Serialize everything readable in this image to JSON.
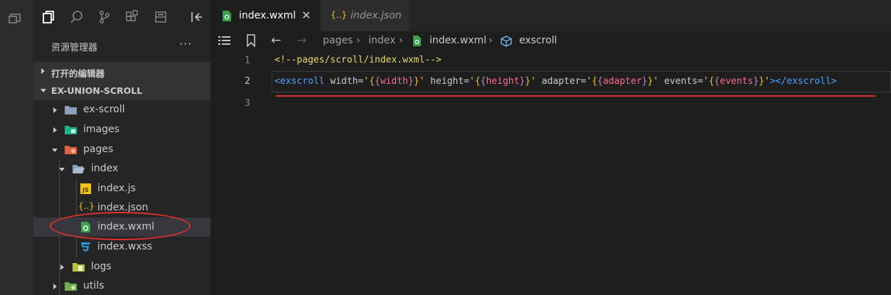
{
  "sidebar": {
    "title": "资源管理器",
    "more": "···",
    "sections": [
      {
        "label": "打开的编辑器",
        "expanded": false
      },
      {
        "label": "EX-UNION-SCROLL",
        "expanded": true
      }
    ],
    "tree": [
      {
        "label": "ex-scroll",
        "kind": "folder",
        "expanded": false
      },
      {
        "label": "images",
        "kind": "folder-images",
        "expanded": false
      },
      {
        "label": "pages",
        "kind": "folder-pages",
        "expanded": true
      },
      {
        "label": "index",
        "kind": "folder-open",
        "expanded": true
      },
      {
        "label": "index.js",
        "kind": "file-js",
        "icon_text": "JS"
      },
      {
        "label": "index.json",
        "kind": "file-json",
        "icon_text": "{..}"
      },
      {
        "label": "index.wxml",
        "kind": "file-wxml",
        "selected": true
      },
      {
        "label": "index.wxss",
        "kind": "file-css"
      },
      {
        "label": "logs",
        "kind": "folder-logs",
        "expanded": false
      },
      {
        "label": "utils",
        "kind": "folder-utils",
        "expanded": false
      }
    ]
  },
  "tabs": [
    {
      "label": "index.wxml",
      "active": true,
      "close": "✕"
    },
    {
      "label": "index.json",
      "active": false,
      "icon_text": "{..}"
    }
  ],
  "breadcrumbs": [
    "pages",
    "index",
    "index.wxml",
    "exscroll"
  ],
  "editor": {
    "line_numbers": [
      "1",
      "2",
      "3"
    ],
    "line1": "<!--pages/scroll/index.wxml-->",
    "line2": {
      "open_tag": "<exscroll",
      "a1": " width=",
      "v1": "width",
      "a2": " height=",
      "v2": "height",
      "a3": " adapter=",
      "v3": "adapter",
      "a4": " events=",
      "v4": "events",
      "close_tag": "</exscroll>"
    }
  },
  "colors": {
    "accent_red": "#e0302d",
    "tag_blue": "#4fa3ff",
    "string_yellow": "#e6db74"
  }
}
